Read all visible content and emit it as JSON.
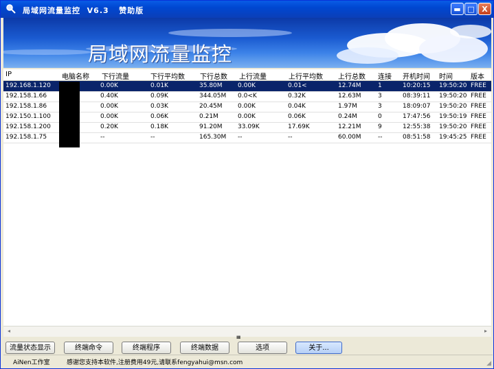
{
  "window": {
    "title": "局域网流量监控  V6.3   赞助版",
    "controls": {
      "minimize": "▬",
      "maximize": "□",
      "close": "X"
    }
  },
  "banner": {
    "title": "局域网流量监控"
  },
  "table": {
    "headers": [
      "IP",
      "电脑名称",
      "下行流量",
      "下行平均数",
      "下行总数",
      "上行流量",
      "上行平均数",
      "上行总数",
      "连接",
      "开机时间",
      "时间",
      "版本"
    ],
    "rows": [
      {
        "ip": "192.168.1.120",
        "name": "",
        "down": "0.00K",
        "down_avg": "0.01K",
        "down_total": "35.80M",
        "up": "0.00K",
        "up_avg": "0.01<",
        "up_total": "12.74M",
        "conn": "1",
        "boot": "10:20:15",
        "time": "19:50:20",
        "ver": "FREE",
        "selected": true
      },
      {
        "ip": "192.158.1.66",
        "name": "",
        "down": "0.40K",
        "down_avg": "0.09K",
        "down_total": "344.05M",
        "up": "0.0<K",
        "up_avg": "0.32K",
        "up_total": "12.63M",
        "conn": "3",
        "boot": "08:39:11",
        "time": "19:50:20",
        "ver": "FREE",
        "selected": false
      },
      {
        "ip": "192.158.1.86",
        "name": "",
        "down": "0.00K",
        "down_avg": "0.03K",
        "down_total": "20.45M",
        "up": "0.00K",
        "up_avg": "0.04K",
        "up_total": "1.97M",
        "conn": "3",
        "boot": "18:09:07",
        "time": "19:50:20",
        "ver": "FREE",
        "selected": false
      },
      {
        "ip": "192.150.1.100",
        "name": "",
        "down": "0.00K",
        "down_avg": "0.06K",
        "down_total": "0.21M",
        "up": "0.00K",
        "up_avg": "0.06K",
        "up_total": "0.24M",
        "conn": "0",
        "boot": "17:47:56",
        "time": "19:50:19",
        "ver": "FREE",
        "selected": false
      },
      {
        "ip": "192.158.1.200",
        "name": "",
        "down": "0.20K",
        "down_avg": "0.18K",
        "down_total": "91.20M",
        "up": "33.09K",
        "up_avg": "17.69K",
        "up_total": "12.21M",
        "conn": "9",
        "boot": "12:55:38",
        "time": "19:50:20",
        "ver": "FREE",
        "selected": false
      },
      {
        "ip": "192.158.1.75",
        "name": "",
        "down": "--",
        "down_avg": "--",
        "down_total": "165.30M",
        "up": "--",
        "up_avg": "--",
        "up_total": "60.00M",
        "conn": "--",
        "boot": "08:51:58",
        "time": "19:45:25",
        "ver": "FREE",
        "selected": false
      }
    ]
  },
  "scrollbar": {
    "left_arrow": "◂",
    "right_arrow": "▸",
    "splitter": "IIIIIII"
  },
  "buttons": {
    "flow_status": "流量状态显示",
    "client_command": "终端命令",
    "client_program": "终端程序",
    "client_data": "终端数据",
    "options": "选项",
    "about": "关于..."
  },
  "status": {
    "studio": "AiNen工作室",
    "message": "感谢您支持本软件,注册费用49元,请联系fengyahui@msn.com"
  },
  "colors": {
    "title_blue": "#0047d1",
    "selection": "#0a246a",
    "banner_sky": "#1a5ad0"
  }
}
